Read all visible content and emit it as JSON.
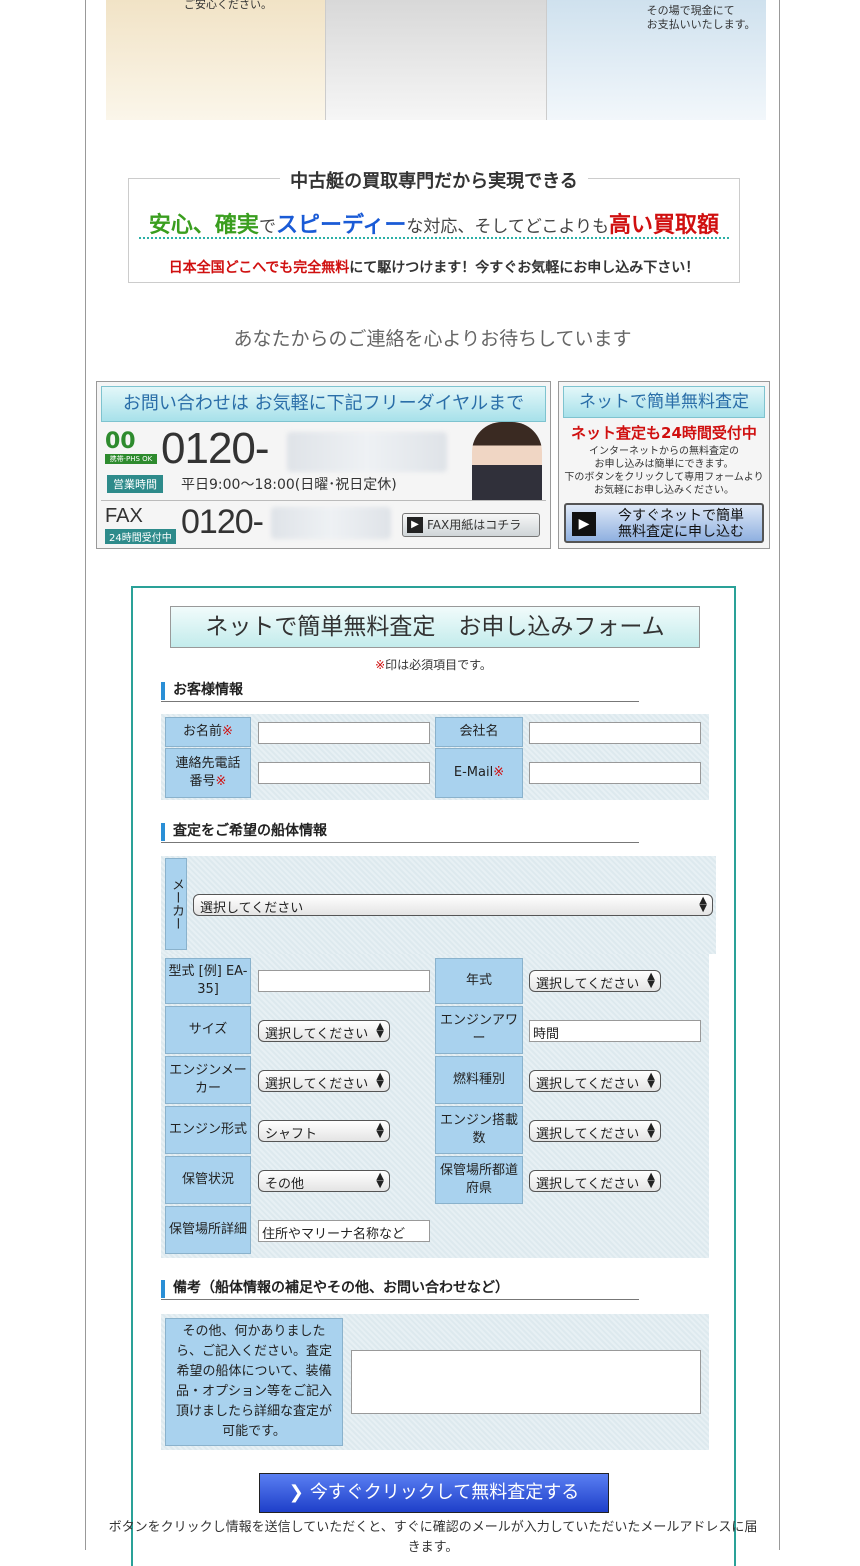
{
  "hero": {
    "left_caption": "ご安心ください。",
    "right_caption_1": "その場で現金にて",
    "right_caption_2": "お支払いいたします。"
  },
  "promo": {
    "title": "中古艇の買取専門だから実現できる",
    "anshin": "安心、確実",
    "de": "で",
    "speedy": "スピーディー",
    "mid": "な対応、そしてどこよりも",
    "high": "高い買取額",
    "sub_red": "日本全国どこへでも完全無料",
    "sub_rest": "にて駆けつけます！今すぐお気軽にお申し込み下さい！"
  },
  "wait_text": "あなたからのご連絡を心よりお待ちしています",
  "contact": {
    "head": "お問い合わせは お気軽に下記フリーダイヤルまで",
    "free_logo": "00",
    "free_small": "携帯·PHS OK",
    "tel_prefix": "0120-",
    "hours_badge": "営業時間",
    "hours": "平日9:00〜18:00(日曜･祝日定休)",
    "fax_label": "FAX",
    "fax_badge": "24時間受付中",
    "fax_prefix": "0120-",
    "fax_button": "FAX用紙はコチラ"
  },
  "netbox": {
    "head": "ネットで簡単無料査定",
    "red": "ネット査定も24時間受付中",
    "line1": "インターネットからの無料査定の",
    "line2": "お申し込みは簡単にできます。",
    "line3": "下のボタンをクリックして専用フォームより",
    "line4": "お気軽にお申し込みください。",
    "button_1": "今すぐネットで簡単",
    "button_2": "無料査定に申し込む"
  },
  "form": {
    "title": "ネットで簡単無料査定　お申し込みフォーム",
    "required_mark": "※",
    "required_note": "印は必須項目です。",
    "section_customer": "お客様情報",
    "section_boat": "査定をご希望の船体情報",
    "section_notes": "備考（船体情報の補足やその他、お問い合わせなど）",
    "name_label": "お名前",
    "company_label": "会社名",
    "phone_label_1": "連絡先電話",
    "phone_label_2": "番号",
    "email_label": "E-Mail",
    "maker_label": "メーカー",
    "maker_value": "選択してください",
    "model_label": "型式 [例] EA-35]",
    "year_label": "年式",
    "year_value": "選択してください",
    "size_label": "サイズ",
    "size_value": "選択してください",
    "power_label": "エンジンアワー",
    "power_value": "時間",
    "engine_maker_label": "エンジンメーカー",
    "engine_maker_value": "選択してください",
    "fuel_label": "燃料種別",
    "fuel_value": "選択してください",
    "engine_type_label": "エンジン形式",
    "engine_type_value": "シャフト",
    "engine_count_label": "エンジン搭載数",
    "engine_count_value": "選択してください",
    "storage_label": "保管状況",
    "storage_value": "その他",
    "pref_label": "保管場所都道府県",
    "pref_value": "選択してください",
    "detail_label": "保管場所詳細",
    "detail_placeholder": "住所やマリーナ名称など",
    "notes_label": "その他、何かありましたら、ご記入ください。査定希望の船体について、装備品・オプション等をご記入頂けましたら詳細な査定が可能です。",
    "submit": "今すぐクリックして無料査定する",
    "footnote": "ボタンをクリックし情報を送信していただくと、すぐに確認のメールが入力していただいたメールアドレスに届きます。"
  }
}
